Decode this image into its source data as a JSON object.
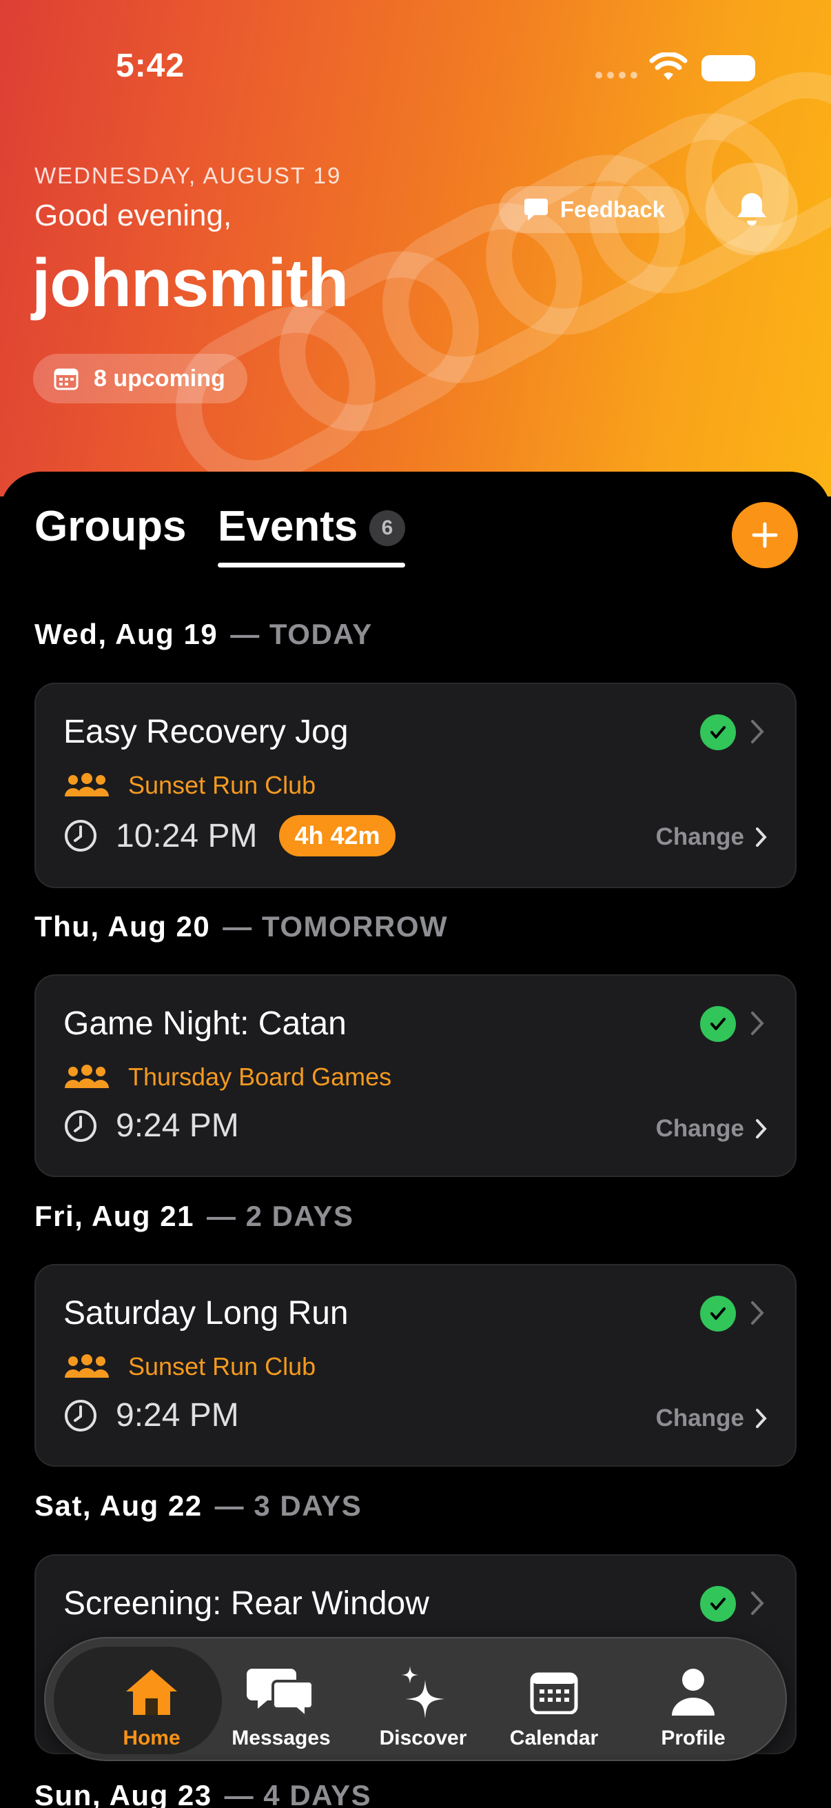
{
  "status_bar": {
    "time": "5:42"
  },
  "header": {
    "date": "WEDNESDAY, AUGUST 19",
    "greeting": "Good evening,",
    "username": "johnsmith",
    "upcoming_label": "8 upcoming",
    "feedback_label": "Feedback"
  },
  "tabs": {
    "groups_label": "Groups",
    "events_label": "Events",
    "events_count": "6"
  },
  "days": [
    {
      "date": "Wed, Aug 19",
      "relative": "— TODAY"
    },
    {
      "date": "Thu, Aug 20",
      "relative": "— TOMORROW"
    },
    {
      "date": "Fri, Aug 21",
      "relative": "— 2 DAYS"
    },
    {
      "date": "Sat, Aug 22",
      "relative": "— 3 DAYS"
    },
    {
      "date": "Sun, Aug 23",
      "relative": "— 4 DAYS"
    }
  ],
  "events": [
    {
      "title": "Easy Recovery Jog",
      "group": "Sunset Run Club",
      "time": "10:24 PM",
      "countdown": "4h 42m",
      "change_label": "Change"
    },
    {
      "title": "Game Night: Catan",
      "group": "Thursday Board Games",
      "time": "9:24 PM",
      "change_label": "Change"
    },
    {
      "title": "Saturday Long Run",
      "group": "Sunset Run Club",
      "time": "9:24 PM",
      "change_label": "Change"
    },
    {
      "title": "Screening: Rear Window"
    }
  ],
  "tabbar": {
    "home": "Home",
    "messages": "Messages",
    "discover": "Discover",
    "calendar": "Calendar",
    "profile": "Profile"
  },
  "colors": {
    "accent": "#fa9316",
    "group_text": "#f59a1f",
    "check_green": "#31c55a",
    "card_bg": "#1c1c1e"
  }
}
